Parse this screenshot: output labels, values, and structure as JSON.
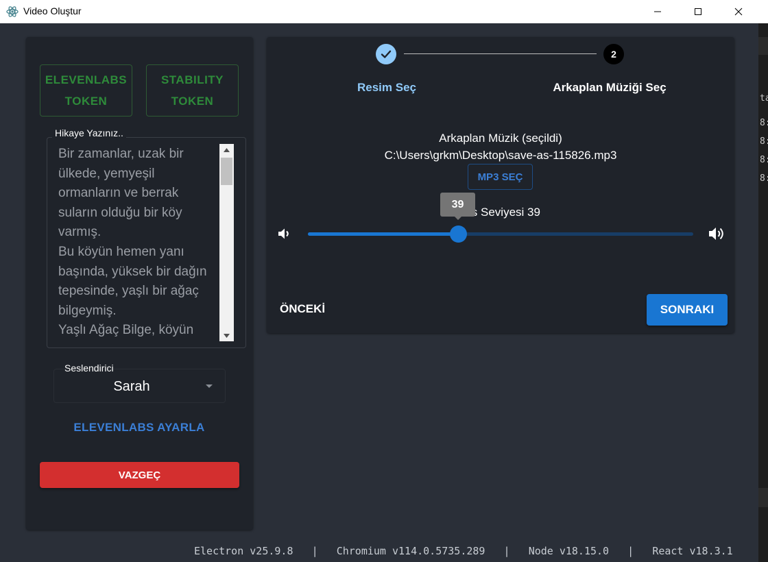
{
  "window": {
    "title": "Video Oluştur"
  },
  "left_panel": {
    "elevenlabs_token_label": "ELEVENLABS TOKEN",
    "stability_token_label": "STABILITY TOKEN",
    "story_label": "Hikaye Yazınız..",
    "story_text": "Bir zamanlar, uzak bir ülkede, yemyeşil ormanların ve berrak suların olduğu bir köy varmış.\nBu köyün hemen yanı başında, yüksek bir dağın tepesinde, yaşlı bir ağaç bilgeymiş.\nYaşlı Ağaç Bilge, köyün",
    "voice_label": "Seslendirici",
    "voice_value": "Sarah",
    "elevenlabs_settings_label": "ELEVENLABS AYARLA",
    "cancel_label": "VAZGEÇ"
  },
  "stepper": {
    "step1_label": "Resim Seç",
    "step2_number": "2",
    "step2_label": "Arkaplan Müziği Seç"
  },
  "music": {
    "title": "Arkaplan Müzik (seçildi)",
    "path": "C:\\Users\\grkm\\Desktop\\save-as-115826.mp3",
    "select_button": "MP3 SEÇ",
    "volume_label": "Ses Seviyesi 39",
    "volume_value": 39,
    "volume_tooltip": "39"
  },
  "nav": {
    "prev_label": "ÖNCEKİ",
    "next_label": "SONRAKI"
  },
  "versions": {
    "electron": "Electron v25.9.8",
    "chromium": "Chromium v114.0.5735.289",
    "node": "Node v18.15.0",
    "react": "React v18.3.1"
  },
  "edge_text": {
    "top": "ta",
    "rows": [
      "8:",
      "8:",
      "8:",
      "8:"
    ]
  },
  "colors": {
    "background": "#2a2f38",
    "panel": "#1f232a",
    "accent_blue": "#1976d2",
    "light_blue": "#90caf9",
    "token_green": "#2e8b3a",
    "cancel_red": "#d32f2f"
  }
}
